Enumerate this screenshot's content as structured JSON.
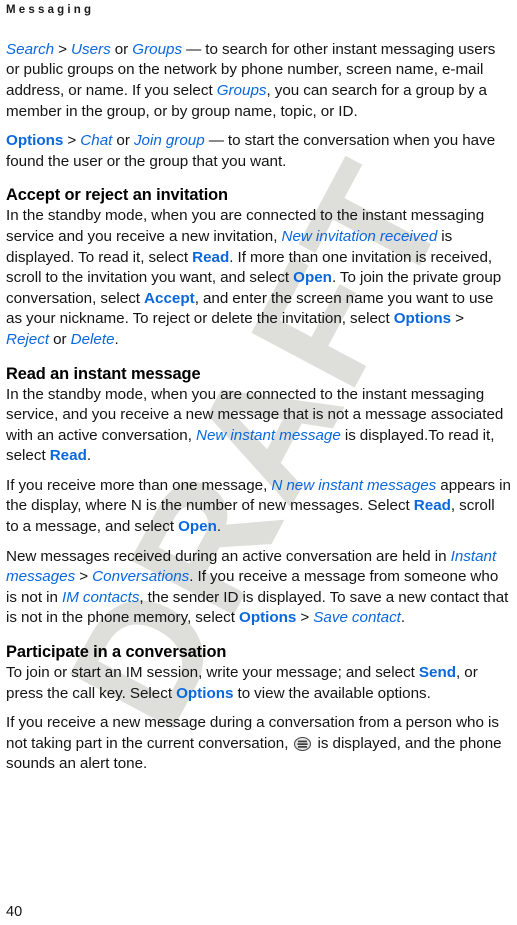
{
  "document": {
    "running_head": "Messaging",
    "page_number": "40",
    "watermark": "DRAFT",
    "accent_color": "#0a68dd",
    "text_color": "#141414",
    "watermark_color": "#dededa"
  },
  "blocks": {
    "search_para": {
      "r1": "Search",
      "r2": " > ",
      "r3": "Users",
      "r4": " or ",
      "r5": "Groups",
      "r6": " — to search for other instant messaging users or public groups on the network by phone number, screen name, e-mail address, or name. If you select ",
      "r7": "Groups",
      "r8": ", you can search for a group by a member in the group, or by group name, topic, or ID."
    },
    "options_para": {
      "r1": "Options",
      "r2": " > ",
      "r3": "Chat",
      "r4": " or ",
      "r5": "Join group",
      "r6": " — to start the conversation when you have found the user or the group that you want."
    },
    "accept_heading": "Accept or reject an invitation",
    "accept_para": {
      "r1": "In the standby mode, when you are connected to the instant messaging service and you receive a new invitation, ",
      "r2": "New invitation received",
      "r3": " is displayed. To read it, select ",
      "r4": "Read",
      "r5": ". If more than one invitation is received, scroll to the invitation you want, and select ",
      "r6": "Open",
      "r7": ". To join the private group conversation, select ",
      "r8": "Accept",
      "r9": ", and enter the screen name you want to use as your nickname. To reject or delete the invitation, select ",
      "r10": "Options",
      "r11": " > ",
      "r12": "Reject",
      "r13": " or ",
      "r14": "Delete",
      "r15": "."
    },
    "read_heading": "Read an instant message",
    "read_para": {
      "r1": "In the standby mode, when you are connected to the instant messaging service, and you receive a new message that is not a message associated with an active conversation, ",
      "r2": "New instant message",
      "r3": " is displayed.To read it, select ",
      "r4": "Read",
      "r5": "."
    },
    "more_para": {
      "r1": "If you receive more than one message, ",
      "r2": "N new instant messages",
      "r3": " appears in the display, where N is the number of new messages. Select ",
      "r4": "Read",
      "r5": ", scroll to a message, and select ",
      "r6": "Open",
      "r7": "."
    },
    "held_para": {
      "r1": "New messages received during an active conversation are held in ",
      "r2": "Instant messages",
      "r3": " > ",
      "r4": "Conversations",
      "r5": ". If you receive a message from someone who is not in ",
      "r6": "IM contacts",
      "r7": ", the sender ID is displayed. To save a new contact that is not in the phone memory, select ",
      "r8": "Options",
      "r9": " > ",
      "r10": "Save contact",
      "r11": "."
    },
    "participate_heading": "Participate in a conversation",
    "participate_para": {
      "r1": "To join or start an IM session, write your message; and select ",
      "r2": "Send",
      "r3": ", or press the call key. Select ",
      "r4": "Options",
      "r5": " to view the available options."
    },
    "alert_para": {
      "r1": "If you receive a new message during a conversation from a person who is not taking part in the current conversation, ",
      "r2": " is displayed, and the phone sounds an alert tone.",
      "icon_name": "new-message-indicator-icon"
    }
  }
}
